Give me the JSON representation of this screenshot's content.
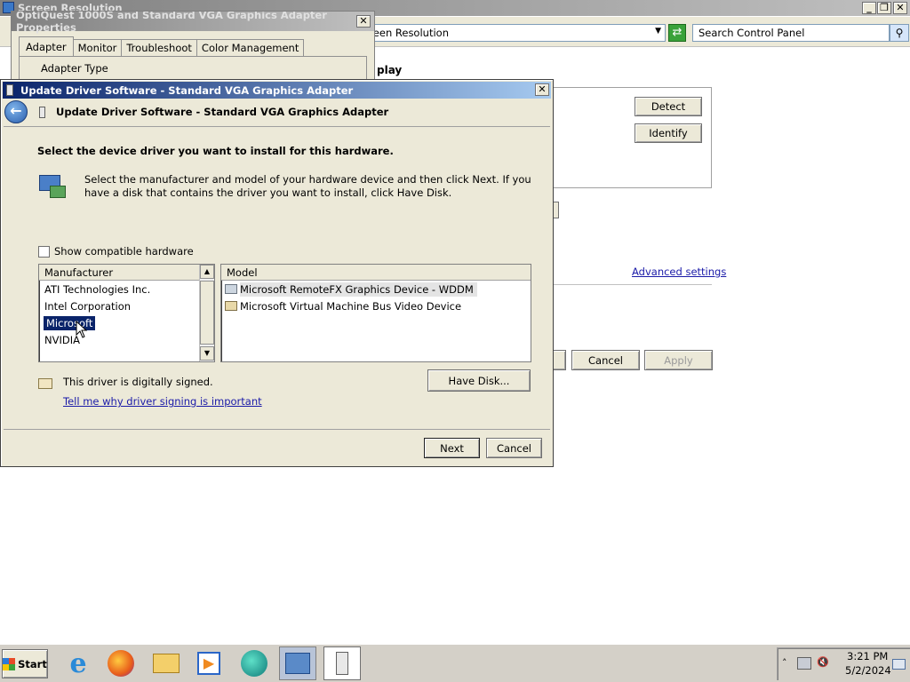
{
  "background_window": {
    "title": "Screen Resolution",
    "address_text": "creen Resolution",
    "search_placeholder": "Search Control Panel",
    "heading_fragment": "play",
    "detect_label": "Detect",
    "identify_label": "Identify",
    "advanced_settings_label": "Advanced settings",
    "cancel_label": "Cancel",
    "apply_label": "Apply"
  },
  "properties_window": {
    "title": "OptiQuest 1000S and Standard VGA Graphics Adapter Properties",
    "tabs": [
      {
        "label": "Adapter"
      },
      {
        "label": "Monitor"
      },
      {
        "label": "Troubleshoot"
      },
      {
        "label": "Color Management"
      }
    ],
    "group_label": "Adapter Type"
  },
  "dialog": {
    "title": "Update Driver Software - Standard VGA Graphics Adapter",
    "nav_title": "Update Driver Software - Standard VGA Graphics Adapter",
    "heading": "Select the device driver you want to install for this hardware.",
    "description": "Select the manufacturer and model of your hardware device and then click Next. If you have a disk that contains the driver you want to install, click Have Disk.",
    "show_compatible_label": "Show compatible hardware",
    "show_compatible_checked": false,
    "manufacturer_header": "Manufacturer",
    "manufacturers": [
      {
        "label": "ATI Technologies Inc."
      },
      {
        "label": "Intel Corporation"
      },
      {
        "label": "Microsoft"
      },
      {
        "label": "NVIDIA"
      }
    ],
    "selected_manufacturer": "Microsoft",
    "model_header": "Model",
    "models": [
      {
        "label": "Microsoft RemoteFX Graphics Device - WDDM"
      },
      {
        "label": "Microsoft Virtual Machine Bus Video Device"
      }
    ],
    "signed_text": "This driver is digitally signed.",
    "signing_link": "Tell me why driver signing is important",
    "have_disk_label": "Have Disk...",
    "next_label": "Next",
    "cancel_label": "Cancel"
  },
  "taskbar": {
    "start_label": "Start",
    "time": "3:21 PM",
    "date": "5/2/2024"
  },
  "colors": {
    "title_gradient_start": "#0a246a",
    "title_gradient_end": "#a6caf0",
    "inactive_title_start": "#808080",
    "inactive_title_end": "#c0c0c0",
    "dialog_face": "#ece9d8",
    "selection": "#0a246a"
  }
}
